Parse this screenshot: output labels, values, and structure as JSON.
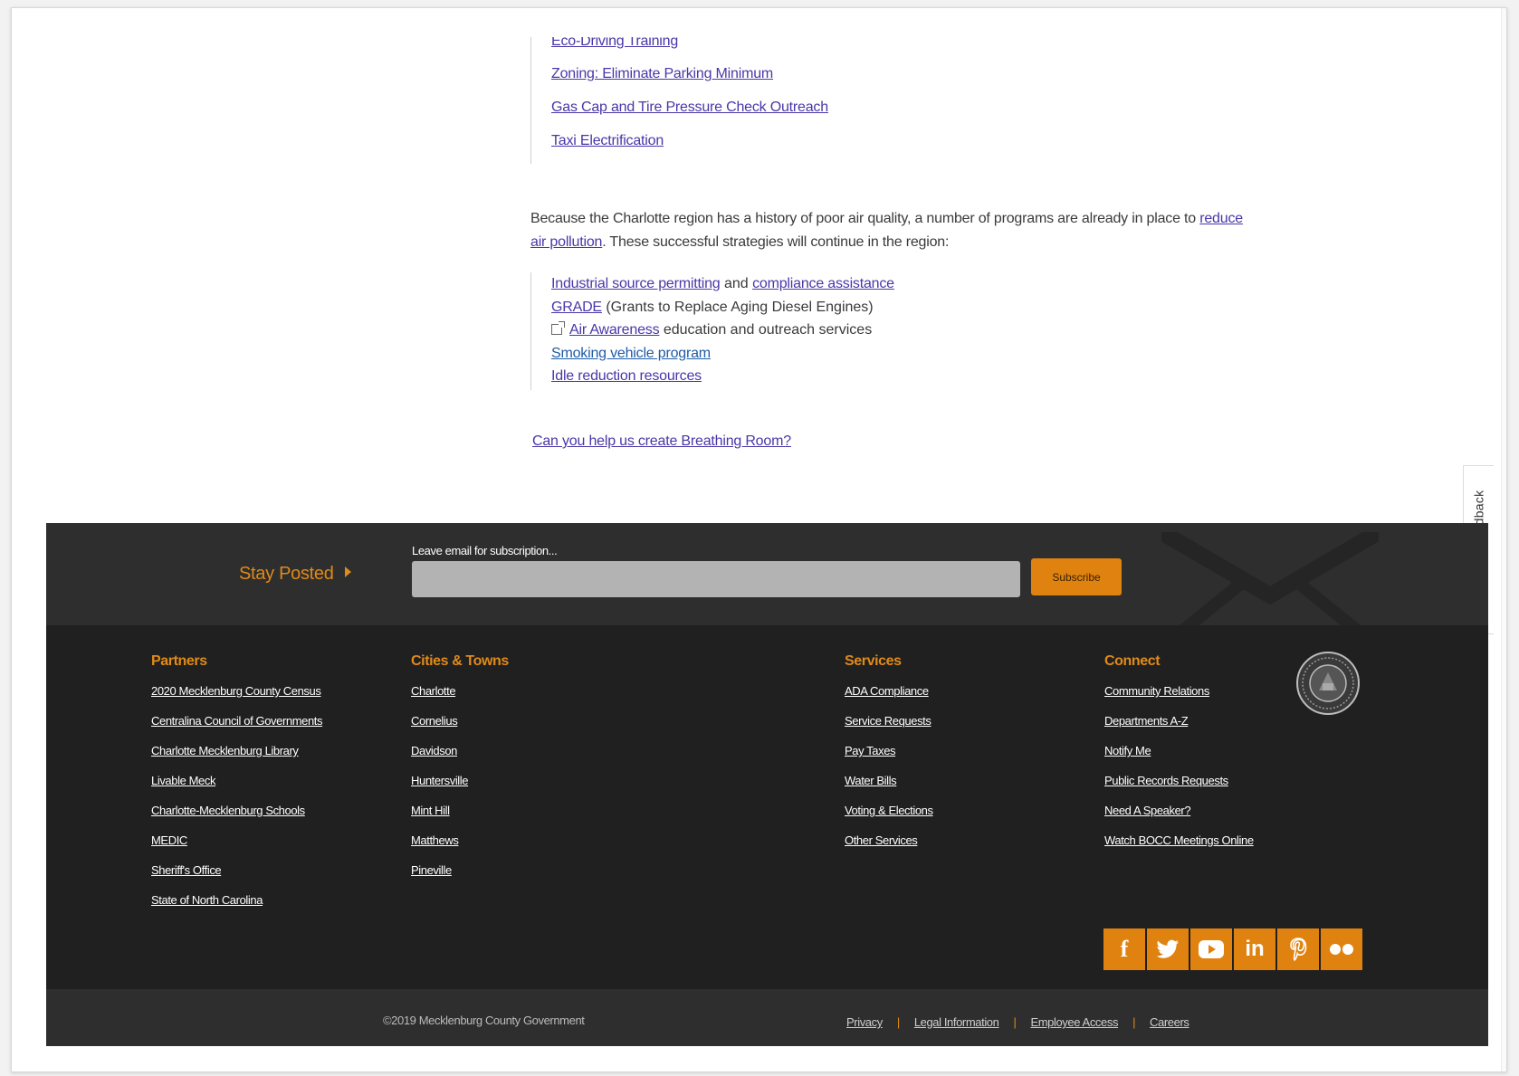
{
  "content": {
    "list1": [
      {
        "label": "Eco-Driving Training"
      },
      {
        "label": "Zoning: Eliminate Parking Minimum"
      },
      {
        "label": "Gas Cap and Tire Pressure Check Outreach"
      },
      {
        "label": "Taxi Electrification"
      }
    ],
    "paragraph": {
      "before": "Because the Charlotte region has a history of poor air quality, a number of programs are already in place to ",
      "link": "reduce air pollution",
      "after": ". These successful strategies will continue in the region:"
    },
    "list2": {
      "item1_link1": "Industrial source permitting",
      "item1_and": " and ",
      "item1_link2": "compliance assistance",
      "item2_link": "GRADE",
      "item2_text": " (Grants to Replace Aging Diesel Engines)",
      "item3_link": "Air Awareness",
      "item3_text": " education and outreach services",
      "item4_link": "Smoking vehicle program",
      "item5_link": "Idle reduction resources"
    },
    "cta": "Can you help us create Breathing Room?"
  },
  "feedback": {
    "label": "Give us feedback",
    "icon": "plus-box-icon"
  },
  "subscribe": {
    "heading": "Stay Posted",
    "email_label": "Leave email for subscription...",
    "email_value": "",
    "button": "Subscribe"
  },
  "footer": {
    "partners": {
      "heading": "Partners",
      "links": [
        "2020 Mecklenburg County Census",
        "Centralina Council of Governments",
        "Charlotte Mecklenburg Library",
        "Livable Meck",
        "Charlotte-Mecklenburg Schools",
        "MEDIC",
        "Sheriff's Office",
        "State of North Carolina"
      ]
    },
    "cities": {
      "heading": "Cities & Towns",
      "links": [
        "Charlotte",
        "Cornelius",
        "Davidson",
        "Huntersville",
        "Mint Hill",
        "Matthews",
        "Pineville"
      ]
    },
    "services": {
      "heading": "Services",
      "links": [
        "ADA Compliance",
        "Service Requests",
        "Pay Taxes",
        "Water Bills",
        "Voting & Elections",
        "Other Services"
      ]
    },
    "connect": {
      "heading": "Connect",
      "links": [
        "Community Relations",
        "Departments A-Z",
        "Notify Me",
        "Public Records Requests",
        "Need A Speaker?",
        "Watch BOCC Meetings Online"
      ]
    },
    "social": [
      {
        "icon": "facebook-icon",
        "glyph": "f"
      },
      {
        "icon": "twitter-icon",
        "glyph": ""
      },
      {
        "icon": "youtube-icon",
        "glyph": ""
      },
      {
        "icon": "linkedin-icon",
        "glyph": "in"
      },
      {
        "icon": "pinterest-icon",
        "glyph": "P"
      },
      {
        "icon": "flickr-icon",
        "glyph": "••"
      }
    ],
    "copyright": "©2019 Mecklenburg County Government",
    "legal": [
      "Privacy",
      "Legal Information",
      "Employee Access",
      "Careers"
    ],
    "accent_color": "#e08210"
  }
}
